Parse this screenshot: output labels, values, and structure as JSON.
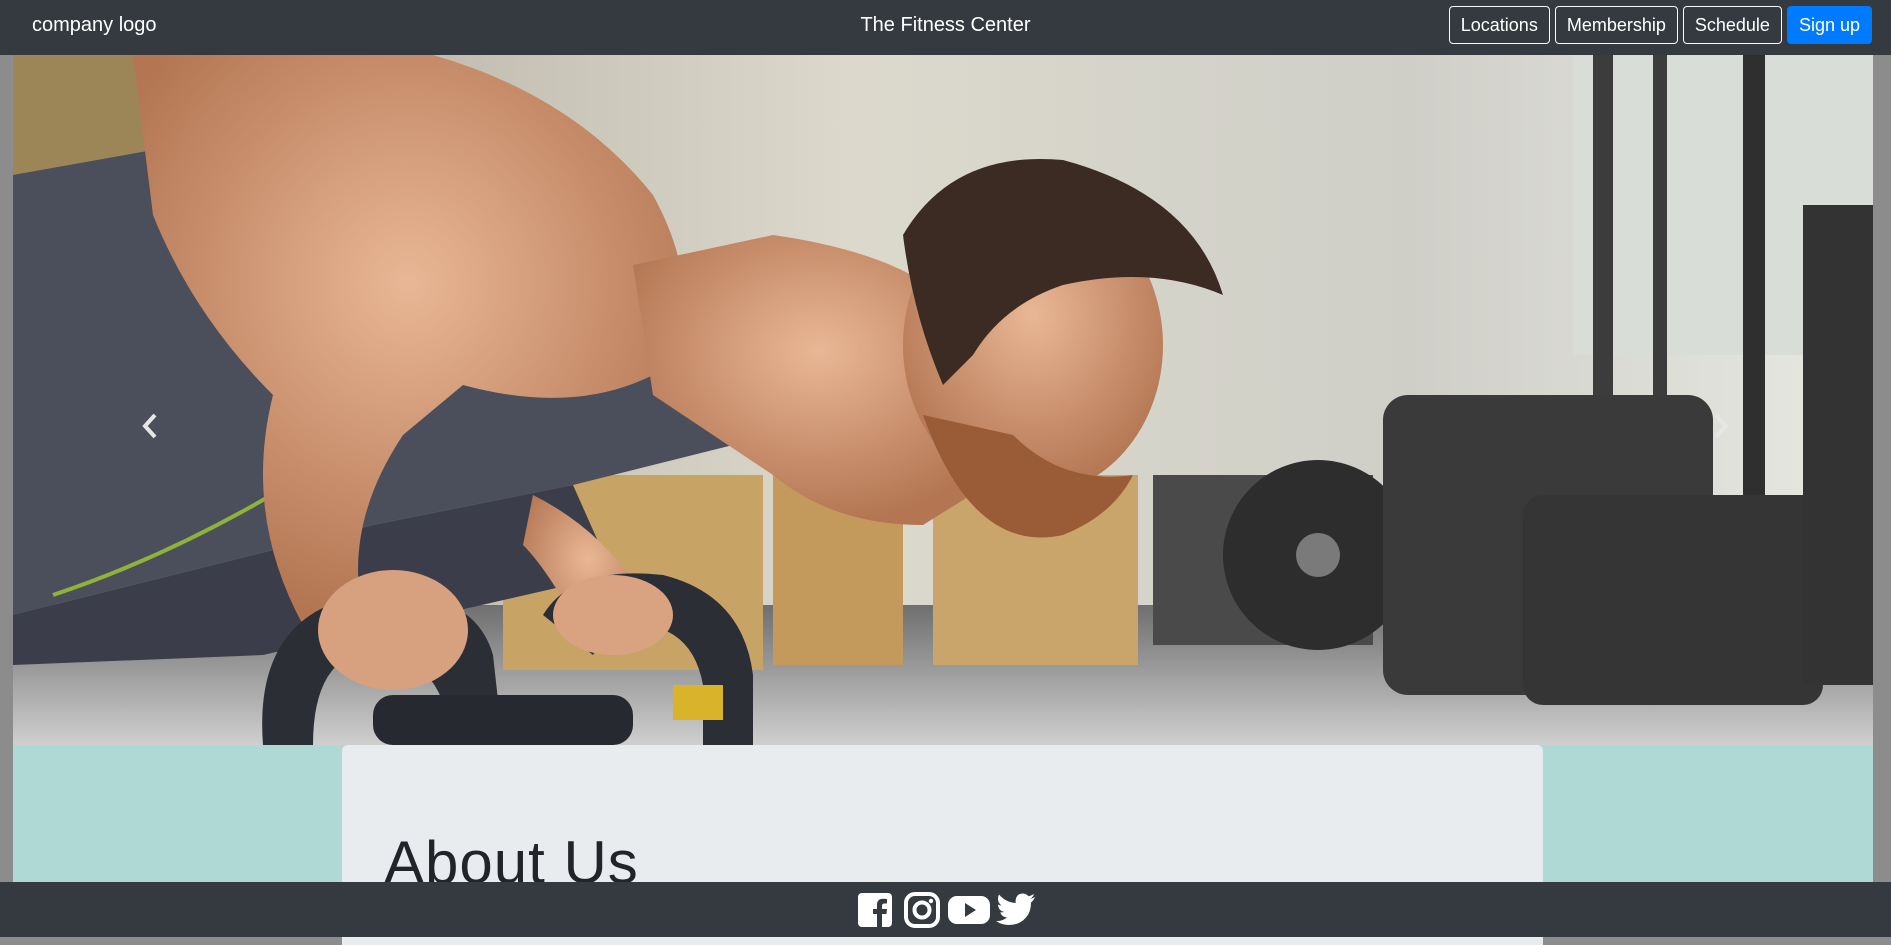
{
  "navbar": {
    "brand": "company logo",
    "title": "The Fitness Center",
    "buttons": [
      {
        "label": "Locations"
      },
      {
        "label": "Membership"
      },
      {
        "label": "Schedule"
      },
      {
        "label": "Sign up"
      }
    ]
  },
  "hero": {
    "image": "man-doing-pushups-on-kettlebells-photo",
    "prev_icon": "chevron-left-icon",
    "next_icon": "chevron-right-icon"
  },
  "about": {
    "heading": "About Us"
  },
  "footer": {
    "social": [
      "facebook-icon",
      "instagram-icon",
      "youtube-icon",
      "twitter-icon"
    ]
  },
  "colors": {
    "navbar": "#343a40",
    "primary": "#007bff",
    "about_bg": "#afd9d5",
    "card_bg": "#e9ecef"
  }
}
